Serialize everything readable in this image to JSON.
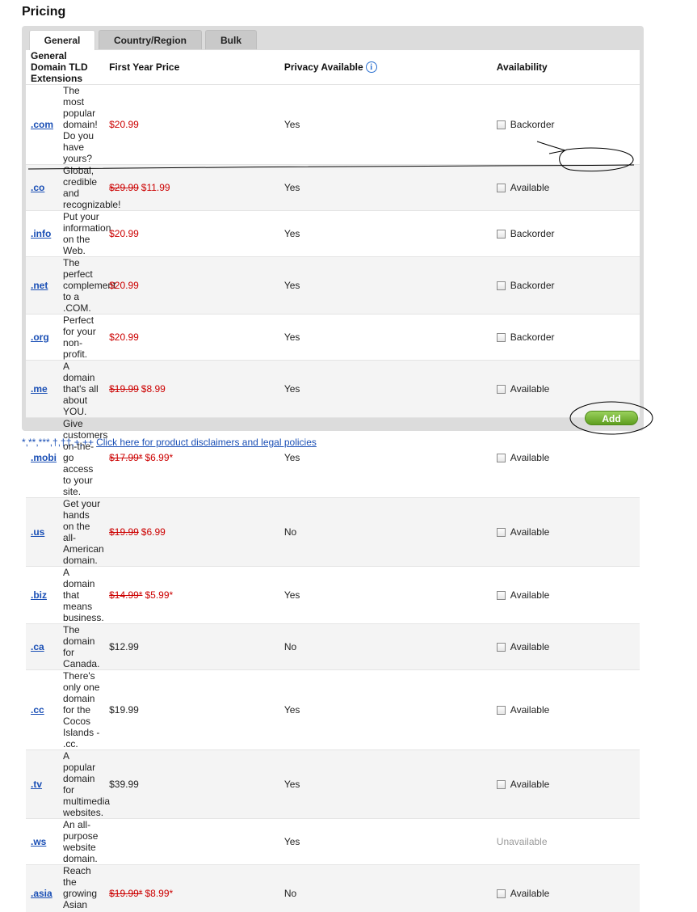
{
  "page": {
    "title": "Pricing"
  },
  "tabs": [
    {
      "label": "General",
      "active": true
    },
    {
      "label": "Country/Region",
      "active": false
    },
    {
      "label": "Bulk",
      "active": false
    }
  ],
  "table": {
    "headers": {
      "tld": "General Domain TLD Extensions",
      "price": "First Year Price",
      "privacy": "Privacy Available",
      "availability": "Availability"
    },
    "rows": [
      {
        "tld": ".com",
        "desc": "The most popular domain! Do you have yours?",
        "old_price": "",
        "price": "$20.99",
        "privacy": "Yes",
        "availability": "Backorder"
      },
      {
        "tld": ".co",
        "desc": "Global, credible and recognizable!",
        "old_price": "$29.99",
        "price": "$11.99",
        "privacy": "Yes",
        "availability": "Available"
      },
      {
        "tld": ".info",
        "desc": "Put your information on the Web.",
        "old_price": "",
        "price": "$20.99",
        "privacy": "Yes",
        "availability": "Backorder"
      },
      {
        "tld": ".net",
        "desc": "The perfect complement to a .COM.",
        "old_price": "",
        "price": "$20.99",
        "privacy": "Yes",
        "availability": "Backorder"
      },
      {
        "tld": ".org",
        "desc": "Perfect for your non-profit.",
        "old_price": "",
        "price": "$20.99",
        "privacy": "Yes",
        "availability": "Backorder"
      },
      {
        "tld": ".me",
        "desc": "A domain that's all about YOU.",
        "old_price": "$19.99",
        "price": "$8.99",
        "privacy": "Yes",
        "availability": "Available"
      },
      {
        "tld": ".mobi",
        "desc": "Give customers on-the-go access to your site.",
        "old_price": "$17.99*",
        "price": "$6.99*",
        "privacy": "Yes",
        "availability": "Available"
      },
      {
        "tld": ".us",
        "desc": "Get your hands on the all-American domain.",
        "old_price": "$19.99",
        "price": "$6.99",
        "privacy": "No",
        "availability": "Available"
      },
      {
        "tld": ".biz",
        "desc": "A domain that means business.",
        "old_price": "$14.99*",
        "price": "$5.99*",
        "privacy": "Yes",
        "availability": "Available"
      },
      {
        "tld": ".ca",
        "desc": "The domain for Canada.",
        "old_price": "",
        "price": "$12.99",
        "privacy": "No",
        "availability": "Available"
      },
      {
        "tld": ".cc",
        "desc": "There's only one domain for the Cocos Islands - .cc.",
        "old_price": "",
        "price": "$19.99",
        "privacy": "Yes",
        "availability": "Available"
      },
      {
        "tld": ".tv",
        "desc": "A popular domain for multimedia websites.",
        "old_price": "",
        "price": "$39.99",
        "privacy": "Yes",
        "availability": "Available"
      },
      {
        "tld": ".ws",
        "desc": "An all-purpose website domain.",
        "old_price": "",
        "price": "",
        "privacy": "Yes",
        "availability": "Unavailable"
      },
      {
        "tld": ".asia",
        "desc": "Reach the growing Asian market.",
        "old_price": "$19.99*",
        "price": "$8.99*",
        "privacy": "No",
        "availability": "Available"
      }
    ]
  },
  "actions": {
    "add_label": "Add"
  },
  "footer": {
    "symbols": "*,**,***,†,††,+,++",
    "link_text": "Click here for product disclaimers and legal policies"
  },
  "icons": {
    "privacy_info": "info-icon",
    "checkbox": "checkbox"
  },
  "colors": {
    "sale_price": "#cc0000",
    "link": "#1a4fb5",
    "add_button": "#6aaa2a"
  }
}
